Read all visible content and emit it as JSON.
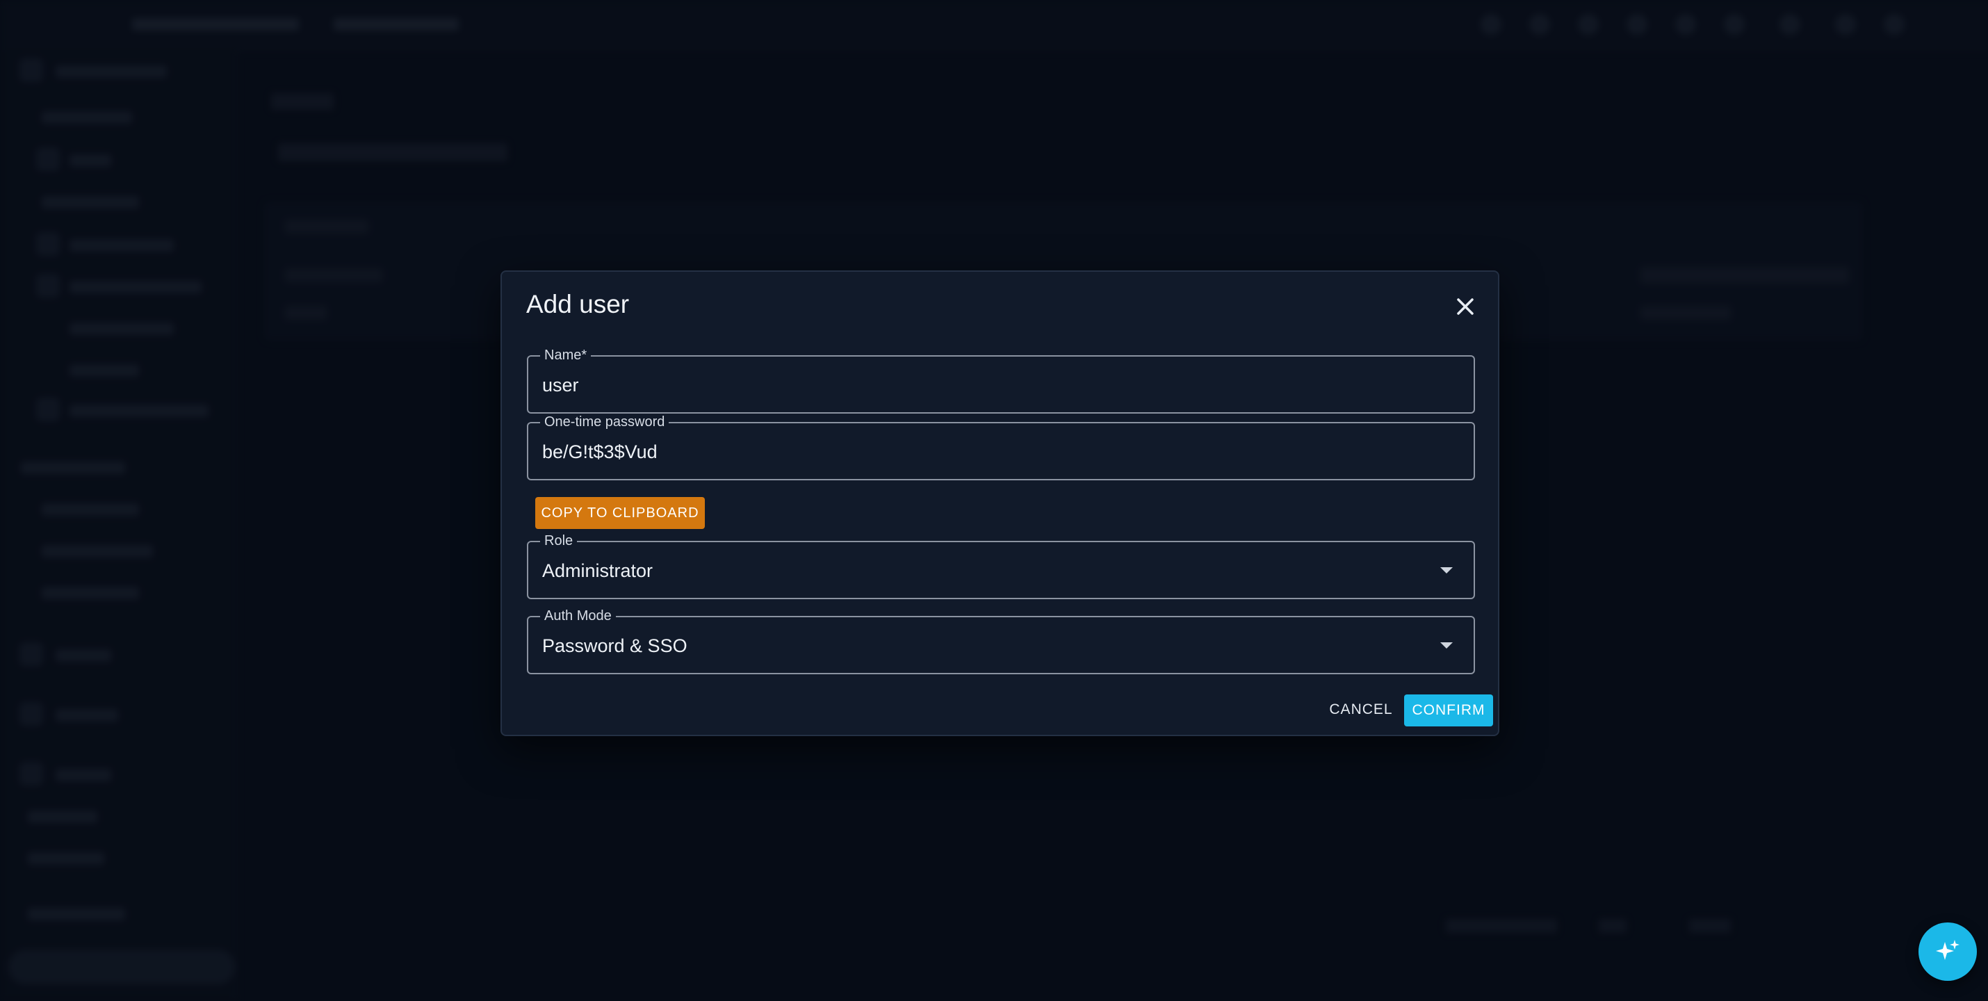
{
  "dialog": {
    "title": "Add user",
    "close_icon": "close-icon",
    "name_field": {
      "label": "Name*",
      "value": "user"
    },
    "password_field": {
      "label": "One-time password",
      "value": "be/G!t$3$Vud"
    },
    "copy_button": "COPY TO CLIPBOARD",
    "role_field": {
      "label": "Role",
      "value": "Administrator"
    },
    "auth_mode_field": {
      "label": "Auth Mode",
      "value": "Password & SSO"
    },
    "cancel_button": "CANCEL",
    "confirm_button": "CONFIRM"
  },
  "fab": {
    "icon": "sparkles-icon"
  },
  "colors": {
    "accent": "#1bb8e8",
    "warning_button": "#d4780f",
    "dialog_background": "#111a2a",
    "page_background": "#0b1220"
  }
}
